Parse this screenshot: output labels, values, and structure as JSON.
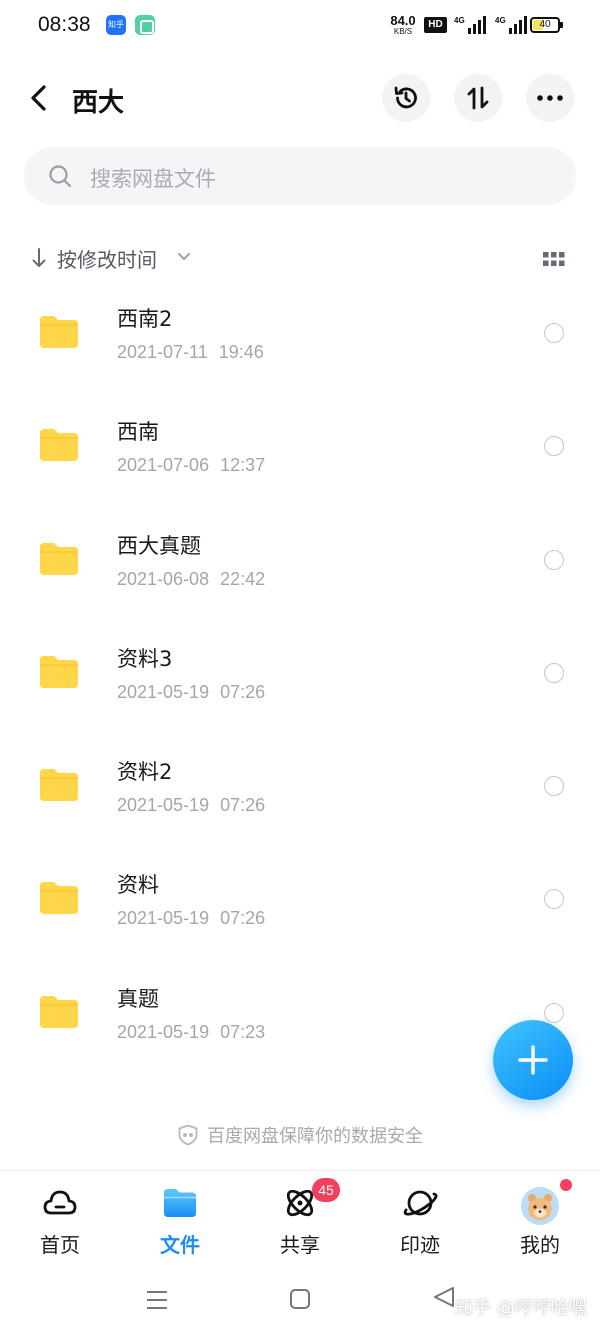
{
  "status_bar": {
    "time": "08:38",
    "app_icon_zhihu": "知乎",
    "net_speed_value": "84.0",
    "net_speed_unit": "KB/S",
    "hd_label": "HD",
    "signal1_label": "4G",
    "signal2_label": "4G",
    "battery": "40",
    "battery_level": 0.4
  },
  "header": {
    "title": "西大",
    "back_icon": "chevron-left-icon",
    "history_icon": "history-icon",
    "sort_icon": "transfer-icon",
    "more_icon": "more-dots-icon"
  },
  "search": {
    "placeholder": "搜索网盘文件"
  },
  "sort": {
    "label": "按修改时间"
  },
  "files": [
    {
      "name": "西南2",
      "date": "2021-07-11 19:46"
    },
    {
      "name": "西南",
      "date": "2021-07-06 12:37"
    },
    {
      "name": "西大真题",
      "date": "2021-06-08 22:42"
    },
    {
      "name": "资料3",
      "date": "2021-05-19 07:26"
    },
    {
      "name": "资料2",
      "date": "2021-05-19 07:26"
    },
    {
      "name": "资料",
      "date": "2021-05-19 07:26"
    },
    {
      "name": "真题",
      "date": "2021-05-19 07:23"
    }
  ],
  "security_note": "百度网盘保障你的数据安全",
  "bottom_nav": {
    "home": "首页",
    "files": "文件",
    "share": "共享",
    "share_badge": "45",
    "trace": "印迹",
    "mine": "我的"
  },
  "watermark": "知乎 @哼哼哈嘿",
  "colors": {
    "accent": "#1c8df5",
    "folder": "#ffd54a",
    "badge": "#f43f5e"
  }
}
